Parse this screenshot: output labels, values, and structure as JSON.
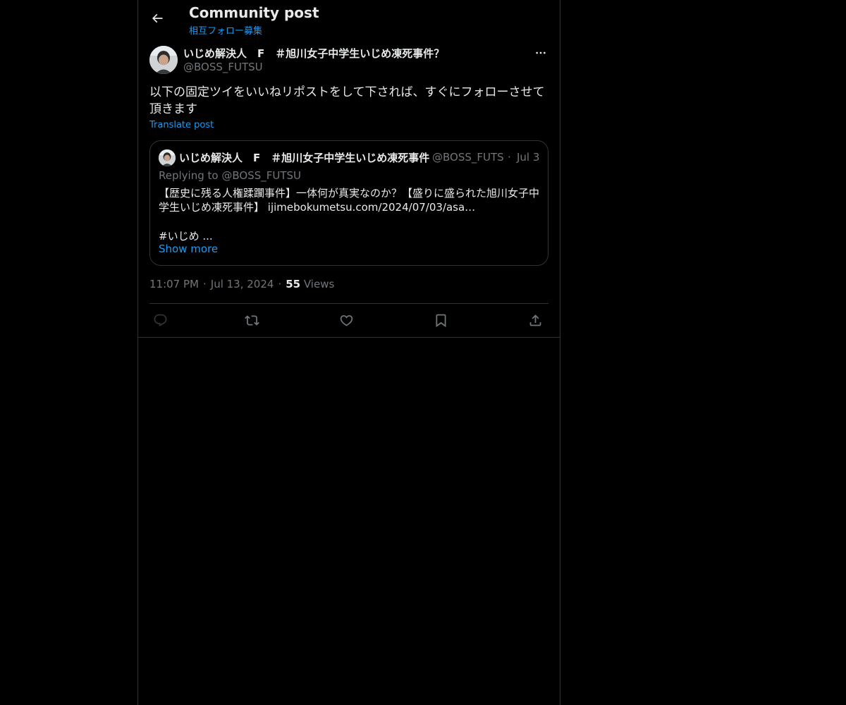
{
  "header": {
    "title": "Community post",
    "subtitle": "相互フォロー募集"
  },
  "post": {
    "author_name": "いじめ解決人　F　＃旭川女子中学生いじめ凍死事件？",
    "author_handle": "@BOSS_FUTSU",
    "text": "以下の固定ツイをいいねリポストをして下されば、すぐにフォローさせて頂きます",
    "translate_label": "Translate post",
    "time": "11:07 PM",
    "date": "Jul 13, 2024",
    "views_count": "55",
    "views_label": "Views"
  },
  "quote": {
    "author_name": "いじめ解決人　F　＃旭川女子中学生いじめ凍死事件",
    "author_handle": "@BOSS_FUTSU",
    "dot": "·",
    "date": "Jul 3",
    "replying_to": "Replying to @BOSS_FUTSU",
    "text": "【歴史に残る人権蹂躙事件】一体何が真実なのか？【盛りに盛られた旭川女子中学生いじめ凍死事件】",
    "link": "ijimebokumetsu.com/2024/07/03/asa…",
    "hashtag_line": "#いじめ ...",
    "show_more": "Show more"
  },
  "icons": {
    "back": "back-arrow-icon",
    "more": "more-horizontal-icon",
    "reply": "reply-icon",
    "repost": "repost-icon",
    "like": "heart-icon",
    "bookmark": "bookmark-icon",
    "share": "share-icon"
  },
  "colors": {
    "background": "#000000",
    "text": "#e7e9ea",
    "secondary": "#71767b",
    "accent": "#1d9bf0",
    "border": "#2f3336"
  }
}
